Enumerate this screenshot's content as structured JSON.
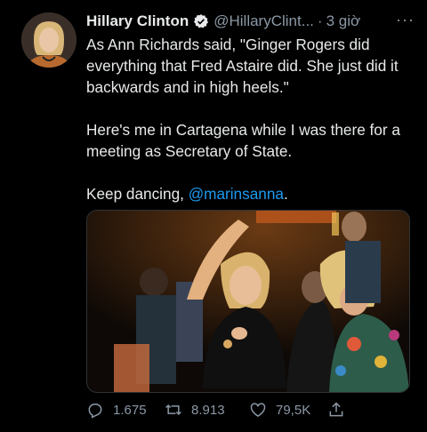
{
  "author": {
    "name": "Hillary Clinton",
    "handle": "@HillaryClint...",
    "separator": "·",
    "time": "3 giờ"
  },
  "more_label": "···",
  "tweet": {
    "paragraph1": "As Ann Richards said, \"Ginger Rogers did everything that Fred Astaire did. She just did it backwards and in high heels.\"",
    "paragraph2": "Here's me in Cartagena while I was there for a meeting as Secretary of State.",
    "paragraph3_prefix": "Keep dancing, ",
    "mention": "@marinsanna",
    "paragraph3_suffix": "."
  },
  "actions": {
    "replies": "1.675",
    "retweets": "8.913",
    "likes": "79,5K"
  },
  "colors": {
    "background": "#000000",
    "text": "#e7e9ea",
    "secondary": "#8b98a5",
    "accent": "#1d9bf0"
  },
  "icons": [
    "verified-badge-icon",
    "more-icon",
    "reply-icon",
    "retweet-icon",
    "like-icon",
    "share-icon"
  ]
}
